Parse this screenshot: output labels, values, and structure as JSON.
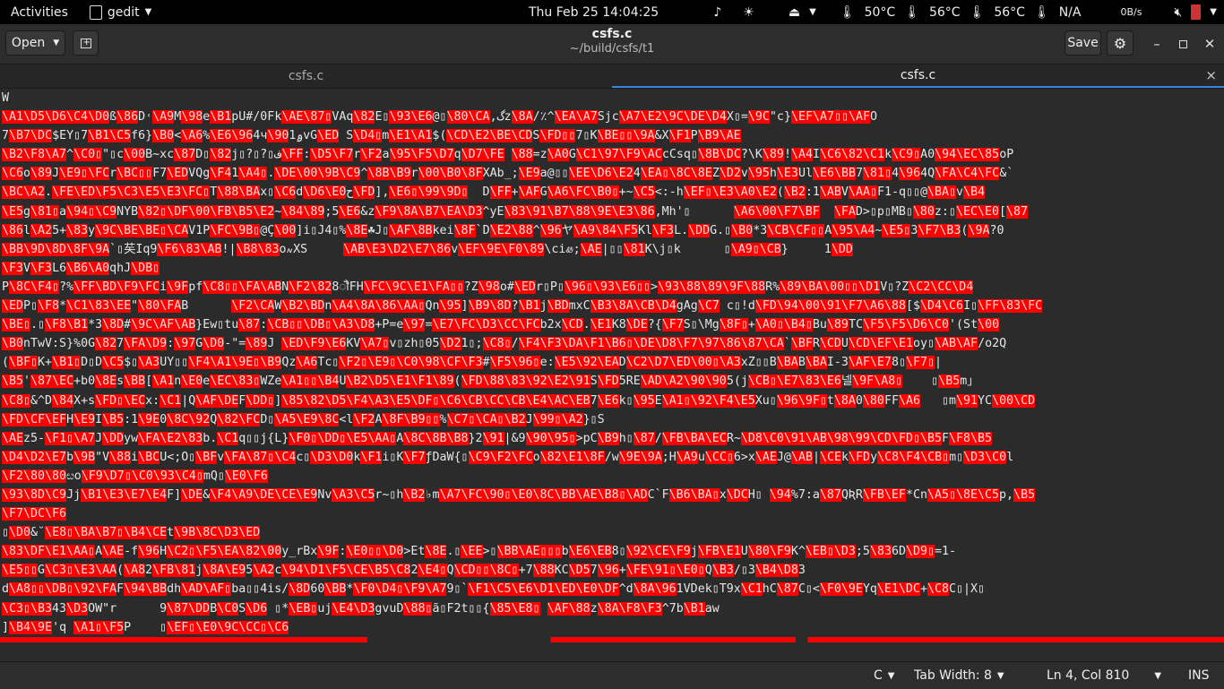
{
  "topbar": {
    "activities": "Activities",
    "app_name": "gedit",
    "clock": "Thu Feb 25  14:04:25",
    "temp1": "50°C",
    "temp2": "56°C",
    "temp3": "56°C",
    "na": "N/A",
    "net_speed": "0B/s"
  },
  "header": {
    "open_label": "Open",
    "title": "csfs.c",
    "subtitle": "~/build/csfs/t1",
    "save_label": "Save"
  },
  "tabs": [
    {
      "label": "csfs.c",
      "close": "×"
    },
    {
      "label": "csfs.c",
      "close": "×"
    }
  ],
  "editor": {
    "lines": [
      [
        [
          "n",
          "W"
        ]
      ],
      [
        [
          "e",
          "\\A1\\D5\\D6\\C4\\D0ß\\86D"
        ],
        [
          "n",
          "˓"
        ],
        [
          "e",
          "\\A9M\\98e\\B1pU#/0Fk\\AE\\87"
        ],
        [
          "n",
          "VAq"
        ],
        [
          "e",
          "\\82E"
        ],
        [
          "n",
          ""
        ],
        [
          "e",
          "\\93\\E6@\\80\\CA,گz\\8A/٪^\\EA\\A7Sjc\\A7\\E2\\9C\\DE\\D4X"
        ],
        [
          "n",
          "=\\9C\"c}"
        ],
        [
          "e",
          "\\EF\\A7"
        ],
        [
          "n",
          ""
        ],
        [
          "e",
          "\\AFO"
        ]
      ]
    ]
  },
  "editor_lines": [
    "W",
    "\\A1\\D5\\D6\\C4\\D0ß\\86D˓\\A9M\\98e\\B1pU#/0Fk\\AE\\87▯VAq\\82E▯\\93\\E6@▯\\80\\CA,گz\\8A/٪^\\EA\\A7Sjc\\A7\\E2\\9C\\DE\\D4X▯=\\9C\"c}\\EF\\A7▯▯\\AFO",
    "7\\B7\\DC$EY▯7\\B1\\C5f6}\\B0<\\A6%\\E6\\964ч\\901ࢫvG\\ED S\\D4▯m\\E1\\A1$(\\CD\\E2\\BE\\CDS\\FD▯▯7▯K\\BE▯▯\\9A&X\\F1P\\B9\\AE",
    "\\B2\\F8\\A7^\\C0▯\"▯c\\00B~xc\\87D▯\\82j▯?▯?▯ف\\FF:\\D5\\F7r\\F2a\\95\\F5\\D7q\\D7\\FE \\88=z\\A0G\\C1\\97\\F9\\ACcCsq▯\\8B\\DC?\\K\\89!\\A4I\\C6\\82\\C1k\\C9▯A0\\94\\EC\\85oP",
    "\\C6o\\89J\\E9▯\\FCr\\BC▯▯F7\\EDVQg\\F41\\A4▯.\\DE\\00\\9B\\C9^\\8B\\B9r\\00\\B0\\8FXAb_;\\E9a@▯▯\\EE\\D6\\E24\\EA▯\\8C\\8EZ\\D2v\\95h\\E3Ul\\E6\\BB7\\81▯4\\964Q\\FA\\C4\\FC&`",
    "\\BC\\A2.\\FE\\ED\\F5\\C3\\E5\\E3\\FC▯T\\88\\BAx▯\\C6d\\D6\\E0ح\\FD],\\E6▯\\99\\9D▯  D\\FF+\\AFG\\A6\\FC\\B0▯+~\\C5<:-h\\EF▯\\E3\\A0\\E2(\\B2:1\\ABV\\AA▯F1-q▯▯@\\BA▯v\\B4",
    "\\E5g\\81▯a\\94▯\\C9NYB\\82▯\\DF\\00\\FB\\B5\\E2~\\84\\89;5\\E6&z\\F9\\8A\\B7\\EA\\D3^yE\\83\\91\\B7\\88\\9E\\E3\\86,Mh'▯      \\A6\\00\\F7\\BF  \\FAD>▯p▯MB▯\\80z:▯\\EC\\E0[\\87",
    "\\86l\\A25+\\83y\\9C\\BE\\BE▯\\CAV1P\\FC\\9B▯@Ç\\00]i▯J4▯%\\8E☘J▯\\AF\\8Bkei\\8F`D\\E2\\88^\\96ヤ\\A9\\84\\F5Kl\\F3L.\\DDG.▯\\B0*3\\CB\\CF▯▯A\\95\\A4~\\E5▯3\\F7\\B3(\\9A?0",
    "\\BB\\9D\\8D\\8F\\9A`▯䒨Iq9\\F6\\83\\AB!|\\B8\\83o៷XS     \\AB\\E3\\D2\\E7\\86v\\EF\\9E\\F0\\89\\ciꮺ;\\AE|▯▯\\81K\\j▯k      ▯\\A9▯\\CB}     1\\DD",
    "\\F3V\\F3L6\\B6\\A0qhJ\\DB▯",
    "P\\8C\\F4▯?%\\FF\\BD\\F9\\FCi\\9Fpf\\C8▯▯\\FA\\ABN\\F2\\828ॏFH\\FC\\9C\\E1\\FA▯▯?Z\\98o#\\EDr▯P▯\\96▯\\93\\E6▯▯>\\93\\88\\89\\9F\\88R%\\89\\BA\\00▯▯\\D1V▯?Z\\C2\\CC\\D4",
    "\\EDP▯\\F8*\\C1\\83\\EE\"\\80\\FAB      \\F2\\CAW\\B2\\BDn\\A4\\8A\\86\\AA▯Qn\\95]\\B9\\8D?\\B1j\\BDmxC\\B3\\8A\\CB\\D4gAg\\C7 c▯!d\\FD\\94\\00\\91\\F7\\A6\\88[$\\D4\\C6I▯\\FF\\83\\FC",
    "\\BE▯.▯\\F8\\B1*3\\8D#\\9C\\AF\\AB}Ew▯tu\\87:\\CB▯▯\\DB▯\\A3\\D8+P=e\\97=\\E7\\FC\\D3\\CC\\FCb2x\\CD.\\E1K8\\DE?{\\F7S▯\\Mg\\8F▯+\\A0▯\\B4▯Bu\\89TC\\F5\\F5\\D6\\C0'(St\\00",
    "\\B0nTwV:S}%0G\\827\\FA\\D9:\\97G\\D0-\"=\\89J \\ED\\F9\\E6KV\\A7▯v▯zh▯05\\D21▯;\\C8▯/\\F4\\F3\\DA\\F1\\B6▯\\DE\\D8\\F7\\97\\86\\87\\CA`\\BFR\\CDU\\CD\\EF\\E1oy▯\\AB\\AF/o2Q",
    "(\\BF▯K+\\B1▯D▯D\\C5$▯\\A3UY▯▯\\F4\\A1\\9E▯\\B9Qz\\A6Tc▯\\F2▯\\E9▯\\C0\\98\\CF\\F3#\\F5\\96▯e:\\E5\\92\\EAD\\C2\\D7\\ED\\00▯\\A3xZ▯▯B\\BAB\\BAI-3\\AF\\E78▯\\F7▯|",
    "\\B5'\\87\\EC+b0\\8Es\\BB[\\A1n\\E0e\\EC\\83▯WZe\\A1▯▯\\B4U\\B2\\D5\\E1\\F1\\89(\\FD\\88\\83\\92\\E2\\91S\\FD5RE\\AD\\A2\\90\\905(j\\CB▯\\E7\\83\\E6넬\\9F\\A8▯    ▯\\B5m」",
    "\\C8▯&^D\\84X+s\\FD▯\\ECx:\\C1|Q\\AF\\DEF\\DD▯]\\85\\82\\D5\\F4\\A3\\E5\\DF▯\\C6\\CB\\CC\\CB\\E4\\AC\\EB7\\E6k▯\\95E\\A1▯\\92\\F4\\E5Xu▯\\96\\9F▯t\\8A0\\80FF\\A6   ▯m\\91YC\\00\\CD",
    "\\FD\\CF\\EFH\\E9I\\B5:1\\9E0\\8C\\92Q\\82\\FCD▯\\A5\\E9\\8C<l\\F2A\\8F\\B9▯▯%\\C7▯\\CA▯\\B2J\\99▯\\A2}▯S",
    "\\AEz5-\\F1▯\\A7J\\DDyw\\FA\\E2\\83b.\\C1q▯▯j{L}\\F0▯\\DD▯\\E5\\AA▯A\\8C\\8B\\B8}2\\91|&9\\90\\95▯>pC\\B9h▯\\87/\\FB\\BA\\ECR~\\D8\\C0\\91\\AB\\98\\99\\CD\\FD▯\\B5F\\F8\\B5",
    "\\D4\\D2\\E7b\\9B\"V\\88i\\BCU<;O▯\\BFv\\FA\\87▯\\C4c▯\\D3\\D0k\\F1i▯K\\F7ƒDaW{▯\\C9\\F2\\FCo\\82\\E1\\8F/w\\9E\\9A;H\\A9u\\CC▯6>x\\AEJ@\\AB|\\CEk\\FDy\\C8\\F4\\CB▯m▯\\D3\\C0l",
    "\\F2\\80\\80ೞo\\F9\\D7▯\\C0\\93\\C4▯mQ▯\\E0\\F6",
    "\\93\\8D\\C9Jj\\B1\\E3\\E7\\E4F]\\DE&\\F4\\A9\\DE\\CE\\E9Nv\\A3\\C5r~▯h\\B2♭m\\A7\\FC\\90▯\\E0\\8C\\BB\\AE\\B8▯\\ADC`F\\B6\\BA▯x\\DCH▯ \\94%7:a\\87QƦR\\FB\\EF*Cn\\A5▯\\8E\\C5p,\\B5",
    "\\F7\\DC\\F6",
    "▯\\D0&˘\\E8▯\\BA\\B7▯\\B4\\CEt\\9B\\8C\\D3\\ED",
    "\\83\\DF\\E1\\AA▯A\\AE-f\\96H\\C2▯\\F5\\EA\\82\\00y_rBx\\9F:\\E0▯▯\\D0>Et\\8E.▯\\EE>▯\\BB\\AE▯▯▯b\\E6\\EB8▯\\92\\CE\\F9j\\FB\\E1U\\80\\F9K^\\EB▯\\D3;5\\836D\\D9▯=1-",
    "\\E5▯▯G\\C3▯\\E3\\AA(\\A82\\FB\\81j\\8A\\E95\\A2c\\94\\D1\\F5\\CE\\B5\\C82\\E4▯Q\\CD▯▯\\8C▯+7\\88KC\\D57\\96+\\FE\\91▯\\E0▯Q\\B3/▯3\\B4\\D83",
    "d\\A8▯▯\\DB▯\\92\\FAF\\94\\BBdh\\AD\\AF▯ba▯▯4is/\\8D60\\BB*\\F0\\D4▯\\F9\\A79▯`\\F1\\C5\\E6\\D1\\ED\\E0\\DF^d\\8A\\961VDek▯T9x\\C1hC\\87C▯<\\F0\\9EYq\\E1\\DC+\\C8C▯|X▯",
    "\\C3▯\\B343\\D3OW\"r      9\\87\\DDB\\C0S\\D6 ▯*\\EB▯uj\\E4\\D3gvuD\\88▯ã▯F2t▯▯{\\85\\E8▯ \\AF\\88z\\8A\\F8\\F3^7b\\B1aw",
    "]\\B4\\9E'q \\A1▯\\F5P    ▯\\EF▯\\E0\\9C\\CC▯\\C6"
  ],
  "status": {
    "language": "C",
    "tab_width": "Tab Width: 8",
    "position": "Ln 4, Col 810",
    "mode": "INS"
  },
  "colors": {
    "highlight": "#ff0000",
    "background": "#2b2b2b",
    "accent": "#3584e4"
  }
}
